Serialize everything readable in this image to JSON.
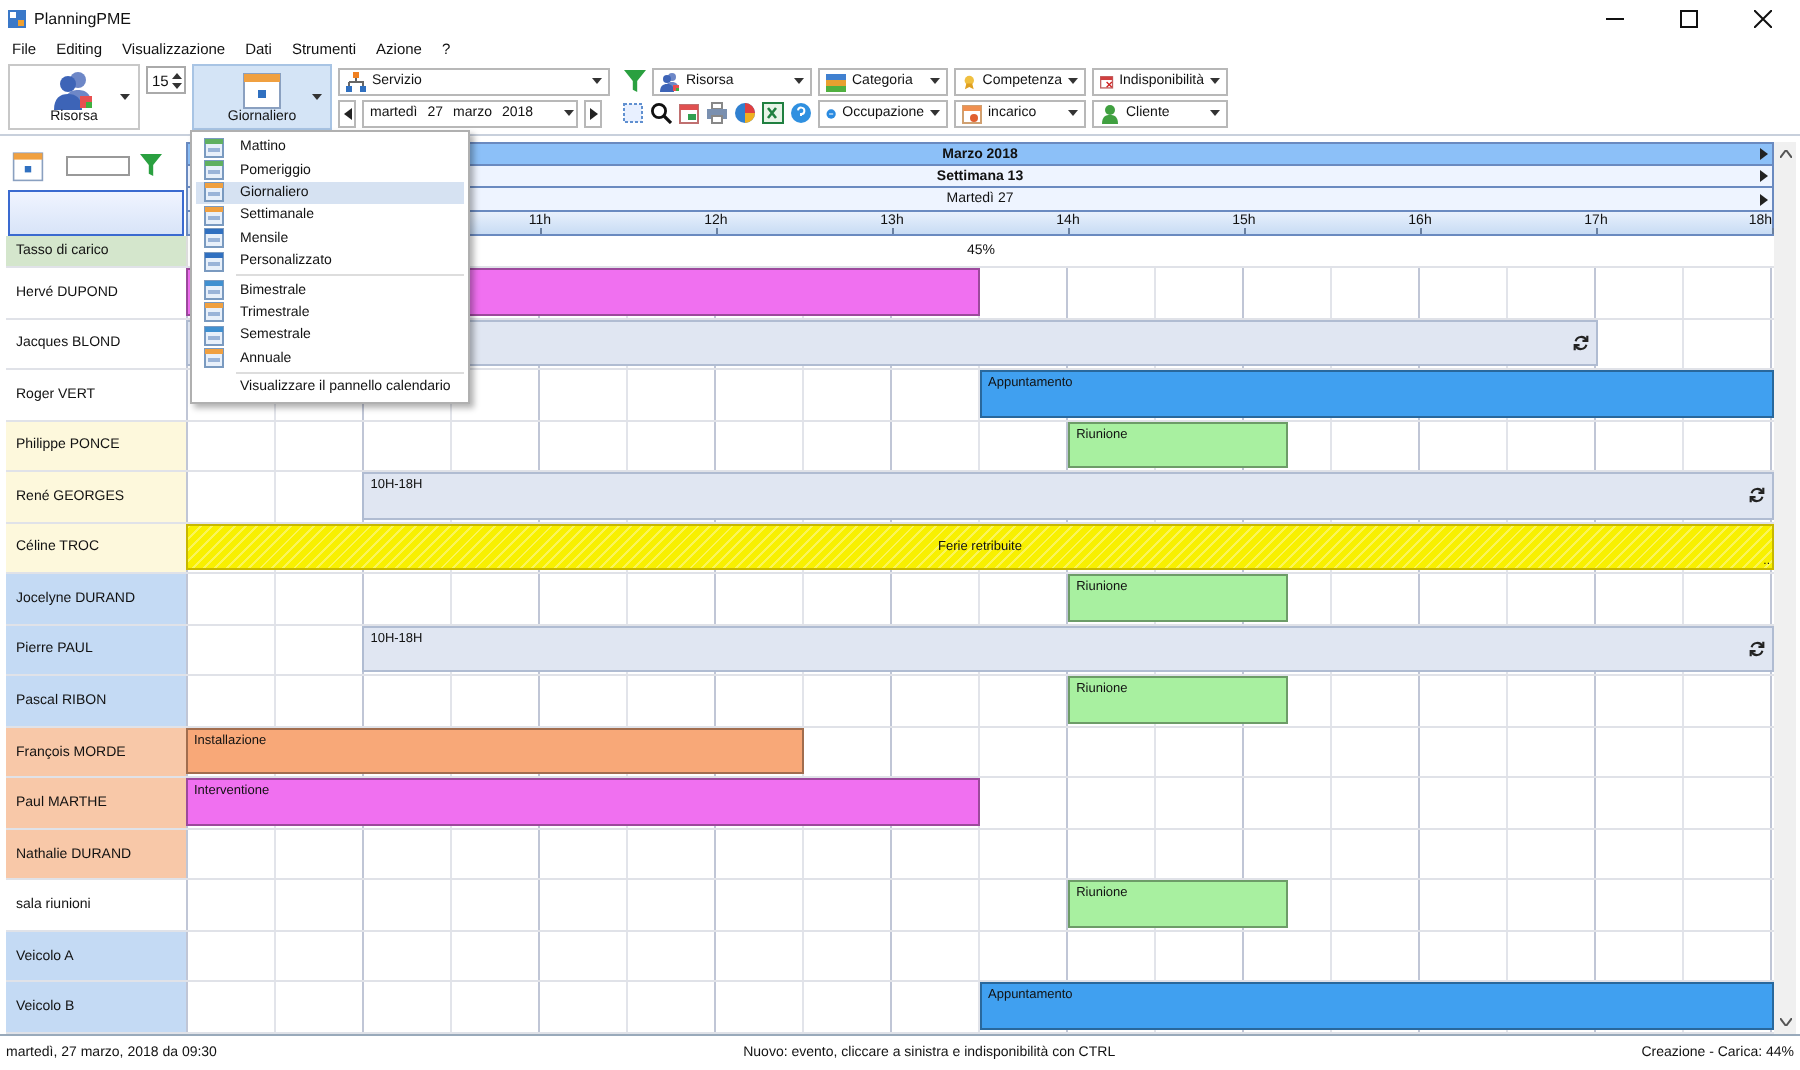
{
  "window": {
    "title": "PlanningPME"
  },
  "menu": [
    "File",
    "Editing",
    "Visualizzazione",
    "Dati",
    "Strumenti",
    "Azione",
    "?"
  ],
  "toolbar": {
    "resource_button": {
      "label": "Risorsa"
    },
    "interval": {
      "value": "15"
    },
    "view_button": {
      "label": "Giornaliero",
      "expanded": true
    },
    "service": {
      "label": "Servizio"
    },
    "date": {
      "weekday": "martedì",
      "day": "27",
      "month": "marzo",
      "year": "2018"
    },
    "filters": [
      {
        "label": "Risorsa"
      },
      {
        "label": "Categoria"
      },
      {
        "label": "Competenza"
      },
      {
        "label": "Indisponibilità"
      },
      {
        "label": "Occupazione"
      },
      {
        "label": "incarico"
      },
      {
        "label": "Cliente"
      }
    ]
  },
  "view_menu": {
    "sections": [
      [
        {
          "label": "Mattino",
          "selected": false
        },
        {
          "label": "Pomeriggio",
          "selected": false
        },
        {
          "label": "Giornaliero",
          "selected": true
        },
        {
          "label": "Settimanale",
          "selected": false
        },
        {
          "label": "Mensile",
          "selected": false
        },
        {
          "label": "Personalizzato",
          "selected": false
        }
      ],
      [
        {
          "label": "Bimestrale",
          "selected": false
        },
        {
          "label": "Trimestrale",
          "selected": false
        },
        {
          "label": "Semestrale",
          "selected": false
        },
        {
          "label": "Annuale",
          "selected": false
        }
      ],
      [
        {
          "label": "Visualizzare il pannello calendario",
          "selected": false
        }
      ]
    ]
  },
  "planner": {
    "month": "Marzo 2018",
    "week": "Settimana 13",
    "day": "Martedì 27",
    "hours": [
      "11h",
      "12h",
      "13h",
      "14h",
      "15h",
      "16h",
      "17h",
      "18h"
    ],
    "load": {
      "label": "Tasso di carico",
      "value": "45%"
    }
  },
  "resources": [
    {
      "name": "Hervé DUPOND",
      "color": "#ffffff",
      "events": [
        {
          "kind": "task",
          "color": "#f070f0"
        }
      ]
    },
    {
      "name": "Jacques BLOND",
      "color": "#ffffff",
      "events": [
        {
          "kind": "availability",
          "color": "#e0e6f2"
        }
      ]
    },
    {
      "name": "Roger VERT",
      "color": "#ffffff",
      "events": [
        {
          "kind": "task",
          "label": "Appuntamento",
          "color": "#40a0f0"
        }
      ]
    },
    {
      "name": "Philippe PONCE",
      "color": "#fdf8dc",
      "events": [
        {
          "kind": "task",
          "label": "Riunione",
          "color": "#a8f0a0"
        }
      ]
    },
    {
      "name": "René GEORGES",
      "color": "#fdf8dc",
      "events": [
        {
          "kind": "availability",
          "label": "10H-18H",
          "color": "#e0e6f2"
        }
      ]
    },
    {
      "name": "Céline TROC",
      "color": "#fdf8dc",
      "events": [
        {
          "kind": "absence",
          "label": "Ferie retribuite",
          "more": "..",
          "color": "#f8f000"
        }
      ]
    },
    {
      "name": "Jocelyne DURAND",
      "color": "#c4daf4",
      "events": [
        {
          "kind": "task",
          "label": "Riunione",
          "color": "#a8f0a0"
        }
      ]
    },
    {
      "name": "Pierre PAUL",
      "color": "#c4daf4",
      "events": [
        {
          "kind": "availability",
          "label": "10H-18H",
          "color": "#e0e6f2"
        }
      ]
    },
    {
      "name": "Pascal RIBON",
      "color": "#c4daf4",
      "events": [
        {
          "kind": "task",
          "label": "Riunione",
          "color": "#a8f0a0"
        }
      ]
    },
    {
      "name": "François MORDE",
      "color": "#f8c8a8",
      "events": [
        {
          "kind": "task",
          "label": "Installazione",
          "color": "#f8a878"
        }
      ]
    },
    {
      "name": "Paul MARTHE",
      "color": "#f8c8a8",
      "events": [
        {
          "kind": "task",
          "label": "Interventione",
          "color": "#f070f0"
        }
      ]
    },
    {
      "name": "Nathalie DURAND",
      "color": "#f8c8a8"
    },
    {
      "name": "sala riunioni",
      "color": "#ffffff",
      "events": [
        {
          "kind": "task",
          "label": "Riunione",
          "color": "#a8f0a0"
        }
      ]
    },
    {
      "name": "Veicolo A",
      "color": "#c4daf4"
    },
    {
      "name": "Veicolo B",
      "color": "#c4daf4",
      "events": [
        {
          "kind": "task",
          "label": "Appuntamento",
          "color": "#40a0f0"
        }
      ]
    }
  ],
  "status_bar": {
    "left": "martedì, 27 marzo, 2018 da 09:30",
    "center": "Nuovo: evento, cliccare a sinistra e indisponibilità con CTRL",
    "right": "Creazione - Carica: 44%"
  }
}
